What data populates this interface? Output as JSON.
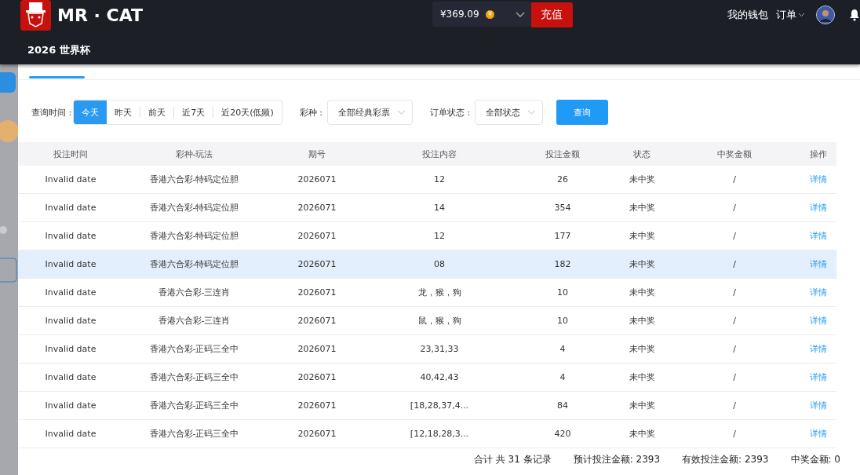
{
  "header": {
    "brand": "MR · CAT",
    "nav": [
      {
        "label": "2026 世界杯"
      }
    ],
    "balance": "¥369.09",
    "coin": "¥",
    "recharge": "充值",
    "wallet": "我的钱包",
    "orders": "订单"
  },
  "filters": {
    "time_label": "查询时间 :",
    "time_options": [
      {
        "label": "今天",
        "selected": true
      },
      {
        "label": "昨天",
        "selected": false
      },
      {
        "label": "前天",
        "selected": false
      },
      {
        "label": "近7天",
        "selected": false
      },
      {
        "label": "近20天(低频)",
        "selected": false
      }
    ],
    "lottery_label": "彩种 :",
    "lottery_value": "全部经典彩票",
    "status_label": "订单状态 :",
    "status_value": "全部状态",
    "query": "查询"
  },
  "table": {
    "columns": [
      "投注时间",
      "彩种-玩法",
      "期号",
      "投注内容",
      "投注金额",
      "状态",
      "中奖金额",
      "操作"
    ],
    "rows": [
      {
        "cells": [
          "Invalid date",
          "香港六合彩-特码定位胆",
          "2026071",
          "12",
          "26",
          "未中奖",
          "/",
          "详情"
        ],
        "selected": false
      },
      {
        "cells": [
          "Invalid date",
          "香港六合彩-特码定位胆",
          "2026071",
          "14",
          "354",
          "未中奖",
          "/",
          "详情"
        ],
        "selected": false
      },
      {
        "cells": [
          "Invalid date",
          "香港六合彩-特码定位胆",
          "2026071",
          "12",
          "177",
          "未中奖",
          "/",
          "详情"
        ],
        "selected": false
      },
      {
        "cells": [
          "Invalid date",
          "香港六合彩-特码定位胆",
          "2026071",
          "08",
          "182",
          "未中奖",
          "/",
          "详情"
        ],
        "selected": true
      },
      {
        "cells": [
          "Invalid date",
          "香港六合彩-三连肖",
          "2026071",
          "龙，猴，狗",
          "10",
          "未中奖",
          "/",
          "详情"
        ],
        "selected": false
      },
      {
        "cells": [
          "Invalid date",
          "香港六合彩-三连肖",
          "2026071",
          "鼠，猴，狗",
          "10",
          "未中奖",
          "/",
          "详情"
        ],
        "selected": false
      },
      {
        "cells": [
          "Invalid date",
          "香港六合彩-正码三全中",
          "2026071",
          "23,31,33",
          "4",
          "未中奖",
          "/",
          "详情"
        ],
        "selected": false
      },
      {
        "cells": [
          "Invalid date",
          "香港六合彩-正码三全中",
          "2026071",
          "40,42,43",
          "4",
          "未中奖",
          "/",
          "详情"
        ],
        "selected": false
      },
      {
        "cells": [
          "Invalid date",
          "香港六合彩-正码三全中",
          "2026071",
          "[18,28,37,4...",
          "84",
          "未中奖",
          "/",
          "详情"
        ],
        "selected": false
      },
      {
        "cells": [
          "Invalid date",
          "香港六合彩-正码三全中",
          "2026071",
          "[12,18,28,3...",
          "420",
          "未中奖",
          "/",
          "详情"
        ],
        "selected": false
      }
    ]
  },
  "summary": [
    "合计 共 31 条记录",
    "预计投注金额: 2393",
    "有效投注金额: 2393",
    "中奖金额: 0"
  ]
}
